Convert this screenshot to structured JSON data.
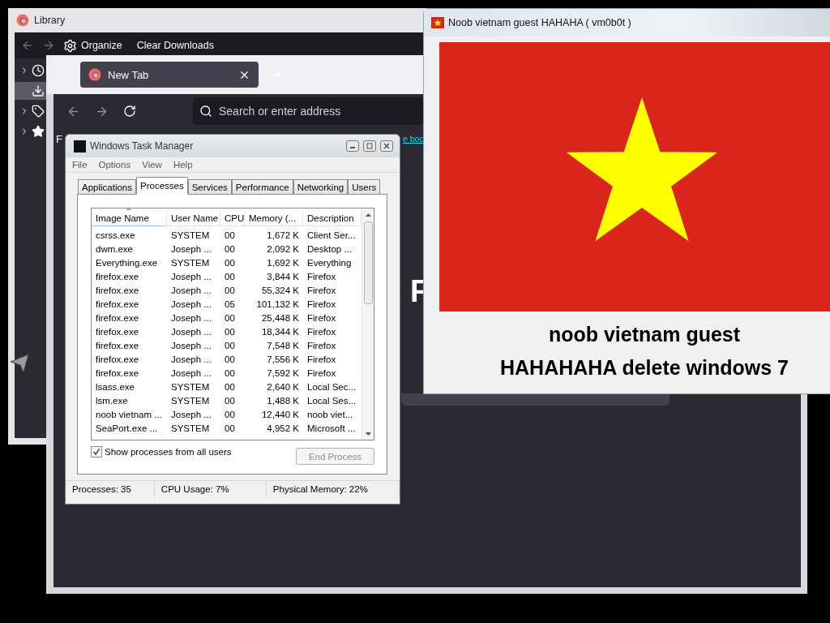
{
  "library_window": {
    "title": "Library",
    "toolbar": {
      "organize": "Organize",
      "clear_downloads": "Clear Downloads"
    },
    "sidebar": {
      "items": [
        {
          "kind": "history",
          "selected": false
        },
        {
          "kind": "downloads",
          "selected": true
        },
        {
          "kind": "tags",
          "selected": false
        },
        {
          "kind": "bookmarks",
          "selected": false
        }
      ]
    }
  },
  "browser_window": {
    "tab": {
      "label": "New Tab"
    },
    "address_bar": {
      "placeholder": "Search or enter address"
    },
    "content": {
      "corner_text": "F",
      "link": "e boo",
      "heading": "F"
    }
  },
  "task_manager": {
    "title": "Windows Task Manager",
    "menu": [
      "File",
      "Options",
      "View",
      "Help"
    ],
    "tabs": [
      {
        "label": "Applications",
        "selected": false
      },
      {
        "label": "Processes",
        "selected": true
      },
      {
        "label": "Services",
        "selected": false
      },
      {
        "label": "Performance",
        "selected": false
      },
      {
        "label": "Networking",
        "selected": false
      },
      {
        "label": "Users",
        "selected": false
      }
    ],
    "columns": [
      {
        "label": "Image Name",
        "sorted": true
      },
      {
        "label": "User Name",
        "sorted": false
      },
      {
        "label": "CPU",
        "sorted": false
      },
      {
        "label": "Memory (...",
        "sorted": false
      },
      {
        "label": "Description",
        "sorted": false
      }
    ],
    "rows": [
      [
        "csrss.exe",
        "SYSTEM",
        "00",
        "1,672 K",
        "Client Ser..."
      ],
      [
        "dwm.exe",
        "Joseph ...",
        "00",
        "2,092 K",
        "Desktop ..."
      ],
      [
        "Everything.exe",
        "SYSTEM",
        "00",
        "1,692 K",
        "Everything"
      ],
      [
        "firefox.exe",
        "Joseph ...",
        "00",
        "3,844 K",
        "Firefox"
      ],
      [
        "firefox.exe",
        "Joseph ...",
        "00",
        "55,324 K",
        "Firefox"
      ],
      [
        "firefox.exe",
        "Joseph ...",
        "05",
        "101,132 K",
        "Firefox"
      ],
      [
        "firefox.exe",
        "Joseph ...",
        "00",
        "25,448 K",
        "Firefox"
      ],
      [
        "firefox.exe",
        "Joseph ...",
        "00",
        "18,344 K",
        "Firefox"
      ],
      [
        "firefox.exe",
        "Joseph ...",
        "00",
        "7,548 K",
        "Firefox"
      ],
      [
        "firefox.exe",
        "Joseph ...",
        "00",
        "7,556 K",
        "Firefox"
      ],
      [
        "firefox.exe",
        "Joseph ...",
        "00",
        "7,592 K",
        "Firefox"
      ],
      [
        "lsass.exe",
        "SYSTEM",
        "00",
        "2,640 K",
        "Local Sec..."
      ],
      [
        "lsm.exe",
        "SYSTEM",
        "00",
        "1,488 K",
        "Local Ses..."
      ],
      [
        "noob vietnam ...",
        "Joseph ...",
        "00",
        "12,440 K",
        "noob viet..."
      ],
      [
        "SeaPort.exe ...",
        "SYSTEM",
        "00",
        "4,952 K",
        "Microsoft ..."
      ]
    ],
    "show_all_users": {
      "label": "Show processes from all users",
      "checked": true
    },
    "end_process": {
      "label": "End Process",
      "disabled": true
    },
    "status": [
      "Processes: 35",
      "CPU Usage: 7%",
      "Physical Memory: 22%"
    ]
  },
  "vietnam_window": {
    "title": "Noob vietnam guest HAHAHA ( vm0b0t )",
    "message": [
      "noob vietnam guest",
      "HAHAHAHA delete windows 7"
    ]
  }
}
